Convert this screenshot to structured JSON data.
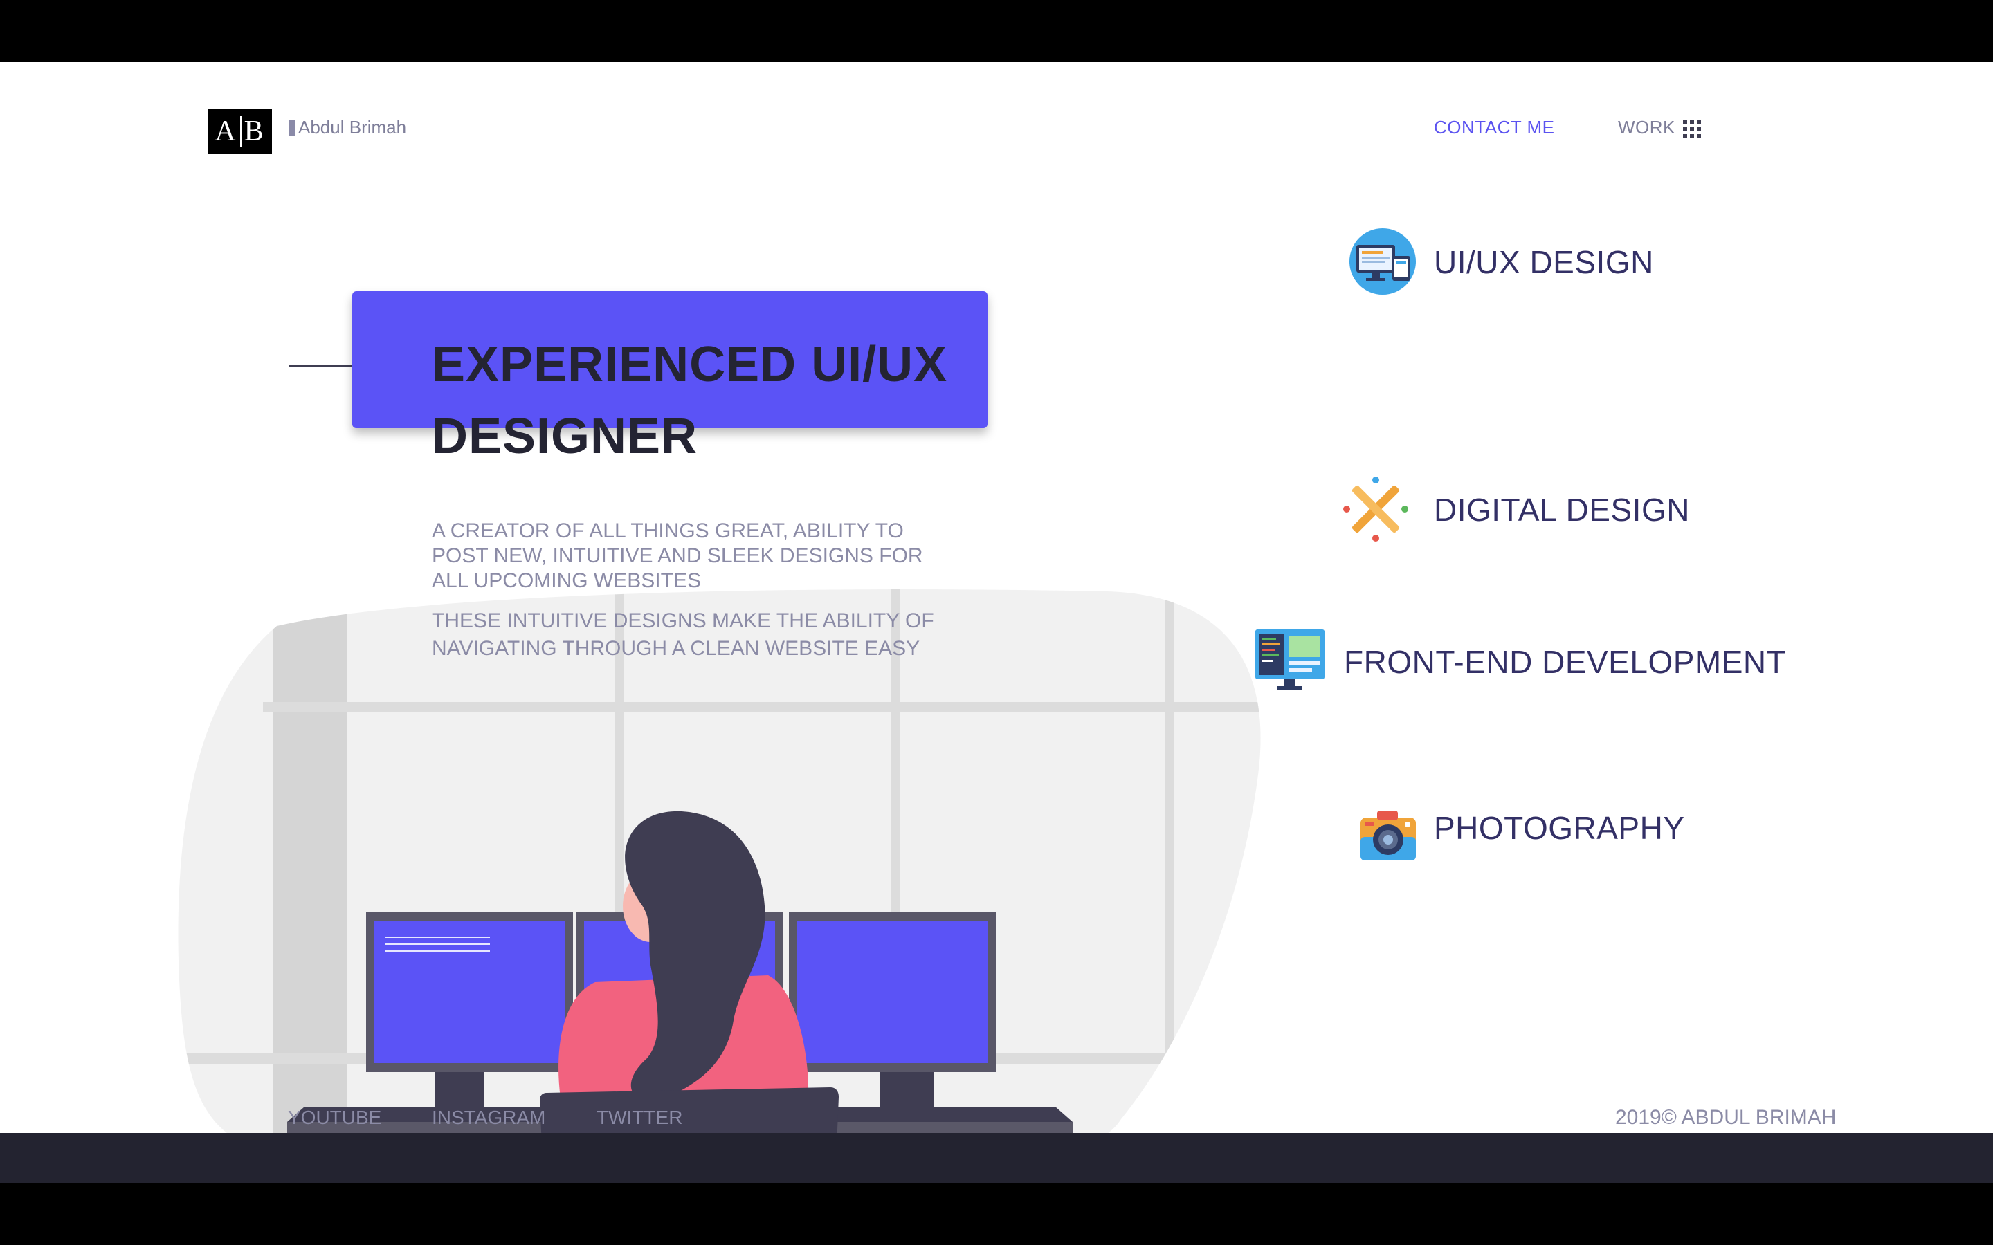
{
  "header": {
    "logo_left": "A",
    "logo_right": "B",
    "brand_name": "Abdul Brimah",
    "nav": {
      "contact": "CONTACT ME",
      "work": "WORK"
    }
  },
  "hero": {
    "title": "EXPERIENCED UI/UX DESIGNER",
    "description": "A CREATOR OF ALL THINGS GREAT, ABILITY TO POST NEW, INTUITIVE AND SLEEK DESIGNS FOR ALL UPCOMING WEBSITES",
    "description2": "THESE INTUITIVE DESIGNS MAKE THE ABILITY OF NAVIGATING THROUGH A CLEAN WEBSITE EASY"
  },
  "services": [
    {
      "label": "UI/UX DESIGN",
      "icon": "ui-ux-icon"
    },
    {
      "label": "DIGITAL DESIGN",
      "icon": "digital-design-icon"
    },
    {
      "label": "FRONT-END DEVELOPMENT",
      "icon": "front-end-icon"
    },
    {
      "label": "PHOTOGRAPHY",
      "icon": "camera-icon"
    }
  ],
  "footer": {
    "social": [
      "YOUTUBE",
      "INSTAGRAM",
      "TWITTER"
    ],
    "copyright": "2019© ABDUL BRIMAH"
  },
  "colors": {
    "accent": "#5b53f6",
    "dark": "#242433",
    "muted": "#8b8ba6",
    "footer_band": "#232330",
    "sweater": "#f2627f"
  }
}
